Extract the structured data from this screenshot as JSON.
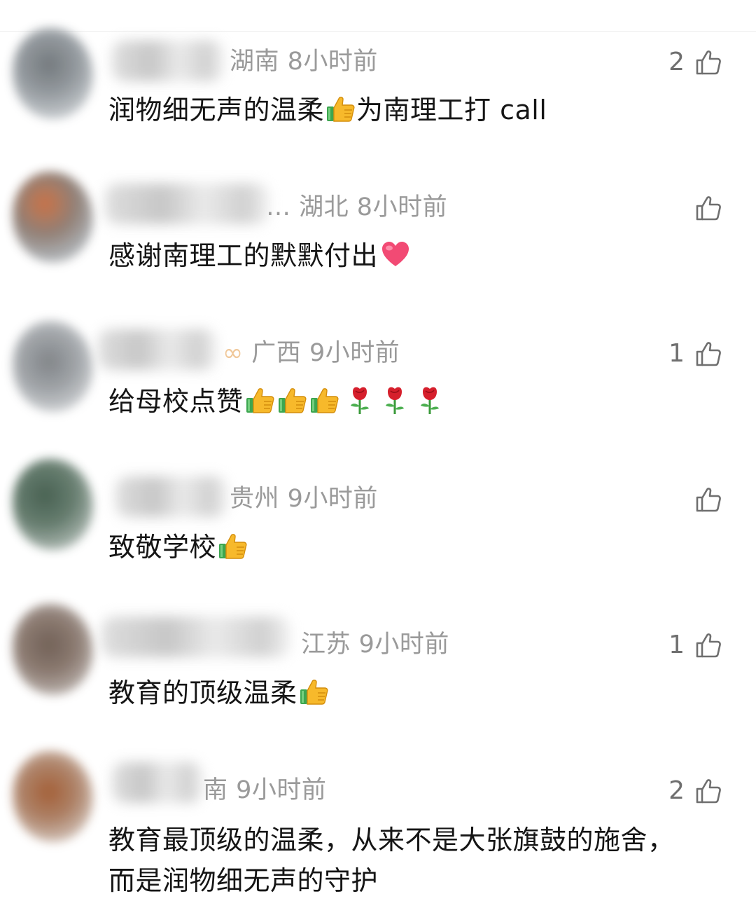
{
  "colors": {
    "meta": "#9a9a9a",
    "text": "#151515",
    "like": "#6f6f6f"
  },
  "comments": [
    {
      "location": "湖南",
      "time": "8小时前",
      "likes": "2",
      "text_a": "润物细无声的温柔",
      "text_b": "为南理工打 call"
    },
    {
      "location": "湖北",
      "time": "8小时前",
      "likes": "",
      "name_tail": "…",
      "text_a": "感谢南理工的默默付出"
    },
    {
      "location": "广西",
      "time": "9小时前",
      "likes": "1",
      "text_a": "给母校点赞"
    },
    {
      "location": "贵州",
      "time": "9小时前",
      "likes": "",
      "text_a": "致敬学校"
    },
    {
      "location": "江苏",
      "time": "9小时前",
      "likes": "1",
      "text_a": "教育的顶级温柔"
    },
    {
      "location": "南",
      "time": "9小时前",
      "likes": "2",
      "text_a": "教育最顶级的温柔，从来不是大张旗鼓的施舍，",
      "text_b": "而是润物细无声的守护"
    }
  ],
  "icons": [
    "thumbs-up-icon",
    "thumbs-up-emoji",
    "heart-emoji",
    "rose-emoji"
  ]
}
